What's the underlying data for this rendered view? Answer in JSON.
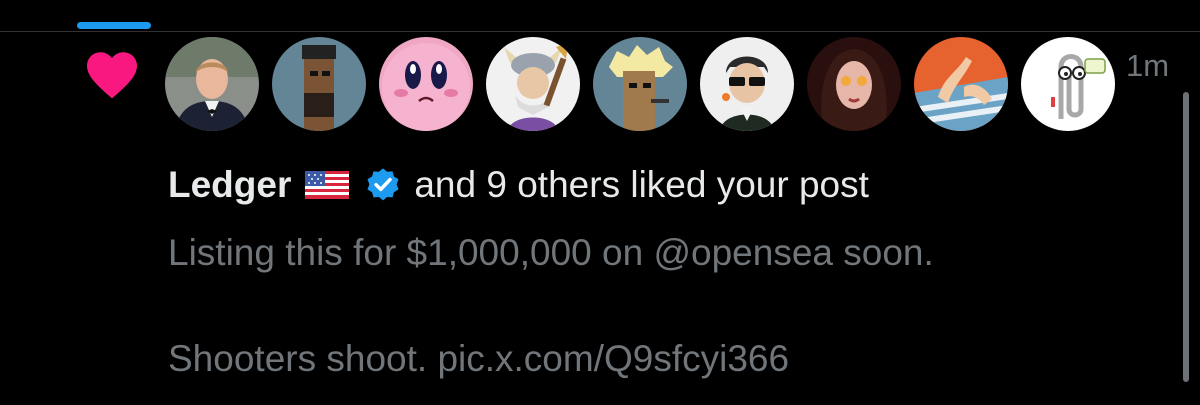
{
  "notification": {
    "type_icon": "heart-icon",
    "avatars": [
      {
        "name": "avatar-1"
      },
      {
        "name": "avatar-2"
      },
      {
        "name": "avatar-3"
      },
      {
        "name": "avatar-4"
      },
      {
        "name": "avatar-5"
      },
      {
        "name": "avatar-6"
      },
      {
        "name": "avatar-7"
      },
      {
        "name": "avatar-8"
      },
      {
        "name": "avatar-9"
      }
    ],
    "timestamp": "1m",
    "user_name": "Ledger",
    "flag_icon": "us-flag-icon",
    "verified_icon": "verified-badge-icon",
    "action_text": "and 9 others liked your post",
    "post_lines": [
      "Listing this for $1,000,000 on @opensea soon.",
      "Shooters shoot. pic.x.com/Q9sfcyi366"
    ]
  },
  "colors": {
    "background": "#000000",
    "accent": "#1d9bf0",
    "heart": "#f91880",
    "primary_text": "#e7e9ea",
    "secondary_text": "#71767b"
  }
}
